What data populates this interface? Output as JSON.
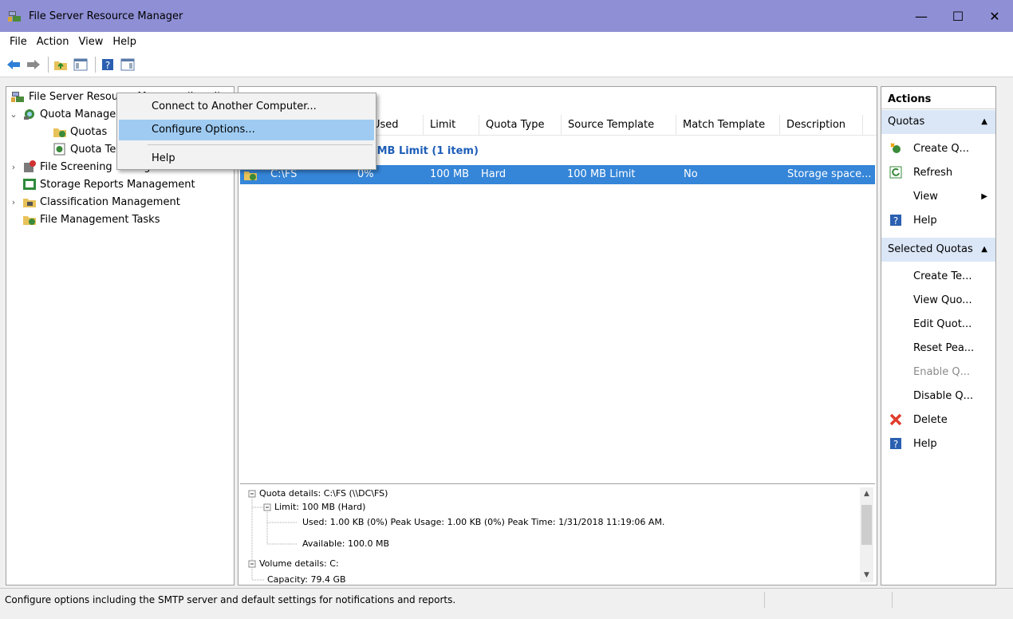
{
  "window": {
    "title": "File Server Resource Manager",
    "minimize": "—",
    "maximize": "☐",
    "close": "✕"
  },
  "menubar": [
    "File",
    "Action",
    "View",
    "Help"
  ],
  "tree": {
    "root": "File Server Resource Manager (Local)",
    "quota_management": "Quota Management",
    "quotas": "Quotas",
    "quota_templates": "Quota Templates",
    "file_screening": "File Screening Management",
    "storage_reports": "Storage Reports Management",
    "classification": "Classification Management",
    "file_management_tasks": "File Management Tasks"
  },
  "context_menu": {
    "items": [
      "Connect to Another Computer...",
      "Configure Options...",
      "Help"
    ]
  },
  "list": {
    "columns": [
      "Used",
      "Limit",
      "Quota Type",
      "Source Template",
      "Match Template",
      "Description"
    ],
    "group": "0 MB Limit (1 item)",
    "row": {
      "path": "C:\\FS",
      "used": "0%",
      "limit": "100 MB",
      "type": "Hard",
      "source": "100 MB Limit",
      "match": "No",
      "description": "Storage space..."
    }
  },
  "details": {
    "l1": "Quota details: C:\\FS (\\\\DC\\FS)",
    "l2": "Limit: 100 MB (Hard)",
    "l3": "Used: 1.00 KB (0%) Peak Usage: 1.00 KB (0%) Peak Time: 1/31/2018 11:19:06 AM.",
    "l4": "Available: 100.0 MB",
    "l5": "Volume details: C:",
    "l6": "Capacity: 79.4 GB"
  },
  "actions": {
    "header": "Actions",
    "section1": "Quotas",
    "create_quota": "Create Q...",
    "refresh": "Refresh",
    "view": "View",
    "help1": "Help",
    "section2": "Selected Quotas",
    "create_template": "Create Te...",
    "view_quota": "View Quo...",
    "edit_quota": "Edit Quot...",
    "reset_peak": "Reset Pea...",
    "enable_quota": "Enable Q...",
    "disable_quota": "Disable Q...",
    "delete": "Delete",
    "help2": "Help"
  },
  "status": "Configure options including the SMTP server and default settings for notifications and reports."
}
